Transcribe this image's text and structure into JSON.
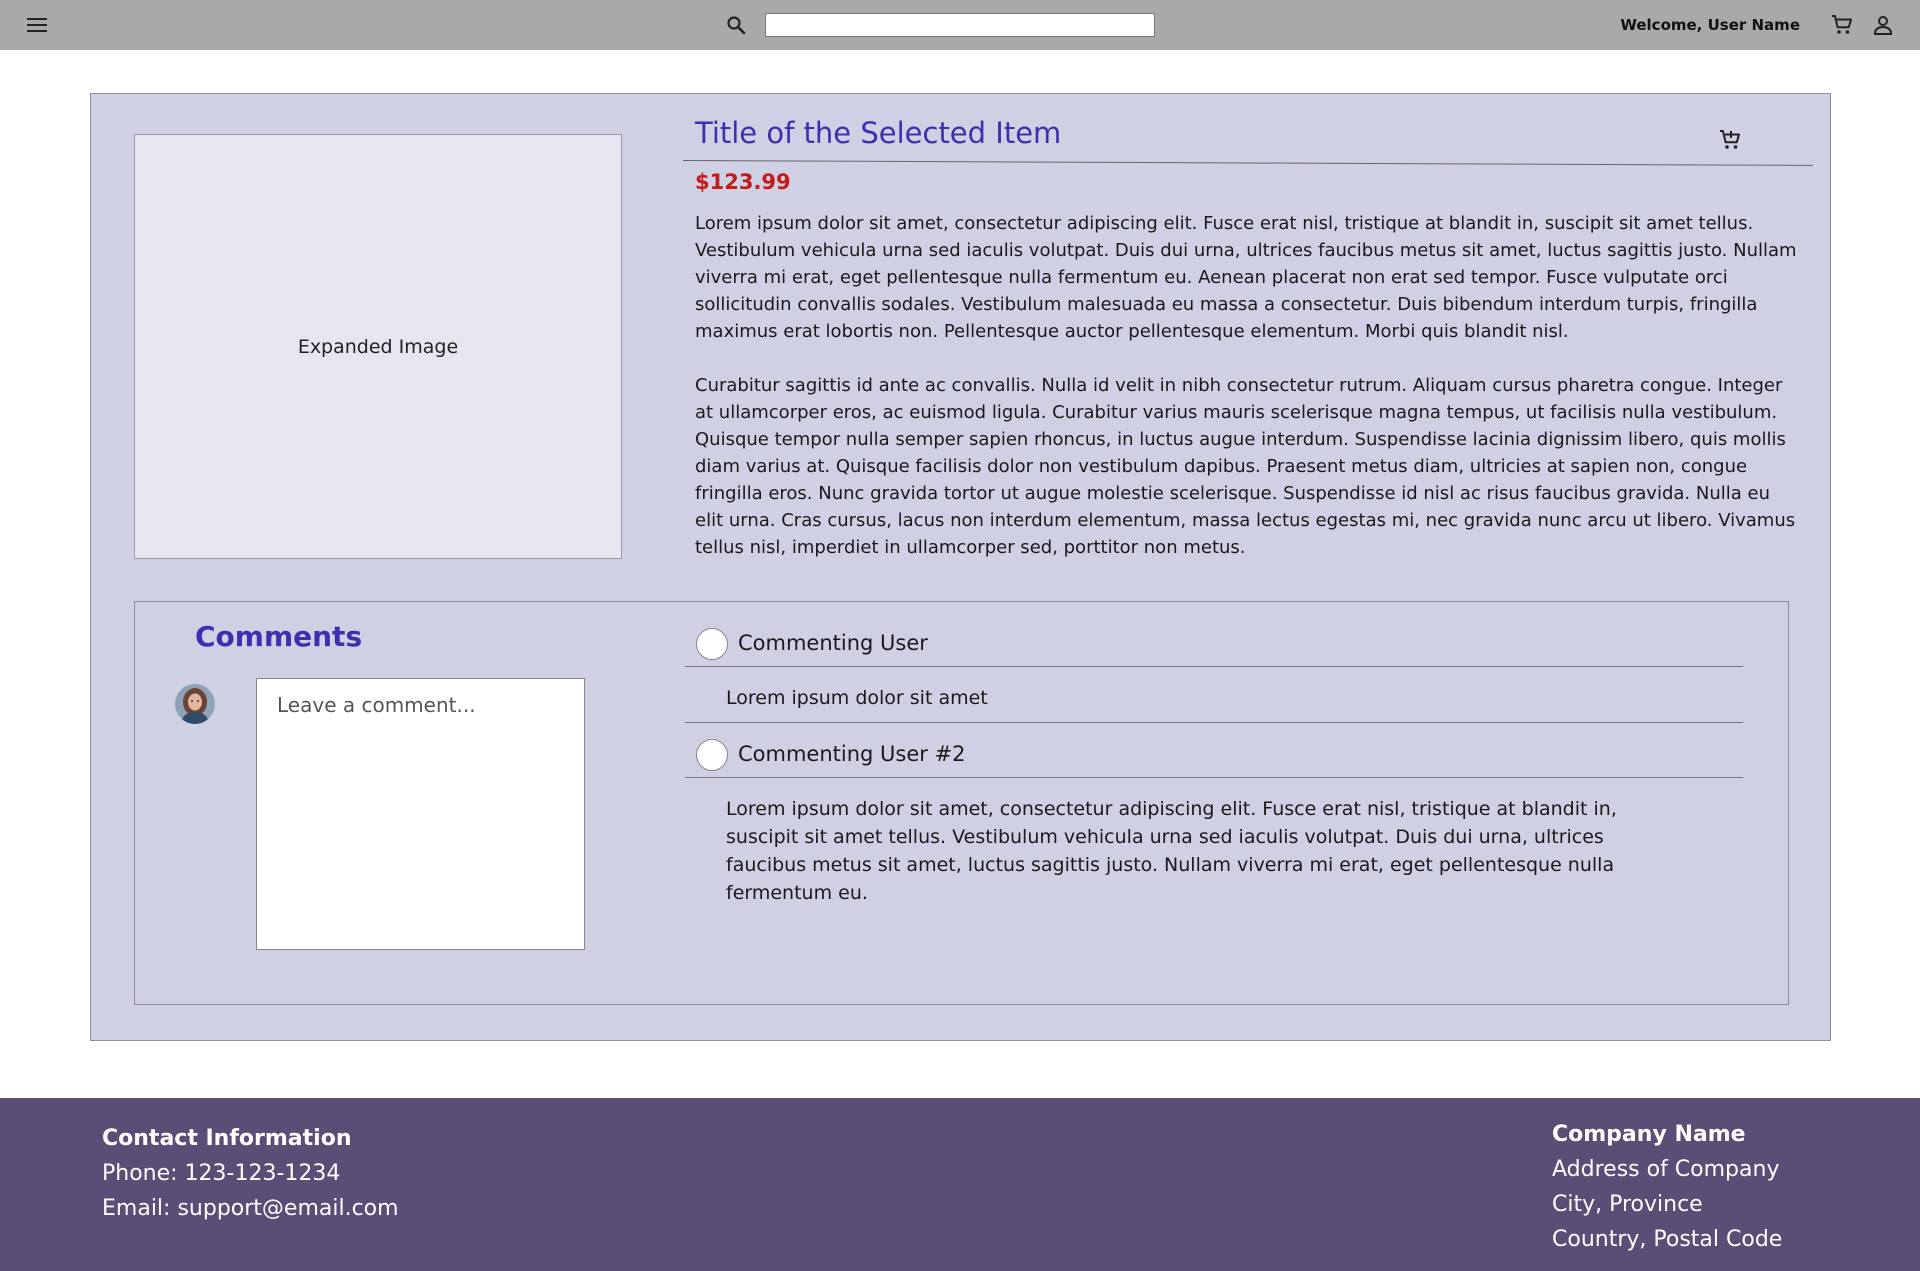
{
  "header": {
    "search_placeholder": "",
    "welcome": "Welcome, User Name"
  },
  "item": {
    "image_label": "Expanded Image",
    "title": "Title of the Selected Item",
    "price": "$123.99",
    "description": [
      "Lorem ipsum dolor sit amet, consectetur adipiscing elit. Fusce erat nisl, tristique at blandit in, suscipit sit amet tellus. Vestibulum vehicula urna sed iaculis volutpat. Duis dui urna, ultrices faucibus metus sit amet, luctus sagittis justo. Nullam viverra mi erat, eget pellentesque nulla fermentum eu. Aenean placerat non erat sed tempor. Fusce vulputate orci sollicitudin convallis sodales. Vestibulum malesuada eu massa a consectetur. Duis bibendum interdum turpis, fringilla maximus erat lobortis non. Pellentesque auctor pellentesque elementum. Morbi quis blandit nisl.",
      "Curabitur sagittis id ante ac convallis. Nulla id velit in nibh consectetur rutrum. Aliquam cursus pharetra congue. Integer at ullamcorper eros, ac euismod ligula. Curabitur varius mauris scelerisque magna tempus, ut facilisis nulla vestibulum. Quisque tempor nulla semper sapien rhoncus, in luctus augue interdum. Suspendisse lacinia dignissim libero, quis mollis diam varius at. Quisque facilisis dolor non vestibulum dapibus. Praesent metus diam, ultricies at sapien non, congue fringilla eros. Nunc gravida tortor ut augue molestie scelerisque. Suspendisse id nisl ac risus faucibus gravida. Nulla eu elit urna. Cras cursus, lacus non interdum elementum, massa lectus egestas mi, nec gravida nunc arcu ut libero. Vivamus tellus nisl, imperdiet in ullamcorper sed, porttitor non metus."
    ]
  },
  "comments": {
    "title": "Comments",
    "input_placeholder": "Leave a comment...",
    "list": [
      {
        "user": "Commenting User",
        "text": "Lorem ipsum dolor sit amet"
      },
      {
        "user": "Commenting User #2",
        "text": "Lorem ipsum dolor sit amet, consectetur adipiscing elit. Fusce erat nisl, tristique at blandit in, suscipit sit amet tellus. Vestibulum vehicula urna sed iaculis volutpat. Duis dui urna, ultrices faucibus metus sit amet, luctus sagittis justo. Nullam viverra mi erat, eget pellentesque nulla fermentum eu."
      }
    ]
  },
  "footer": {
    "contact_title": "Contact Information",
    "phone": "Phone: 123-123-1234",
    "email": "Email: support@email.com",
    "company_name": "Company Name",
    "address": "Address of Company",
    "city": "City, Province",
    "country": "Country, Postal Code"
  },
  "icons": {
    "menu": "menu-icon",
    "search": "search-icon",
    "cart": "cart-icon",
    "user": "user-icon",
    "add_to_cart": "add-to-cart-icon",
    "avatar": "avatar-image"
  },
  "colors": {
    "topbar": "#a9a9a9",
    "card": "#cfd0e3",
    "title": "#3f2fb0",
    "price": "#c41a1a",
    "footer": "#5a4d76"
  }
}
